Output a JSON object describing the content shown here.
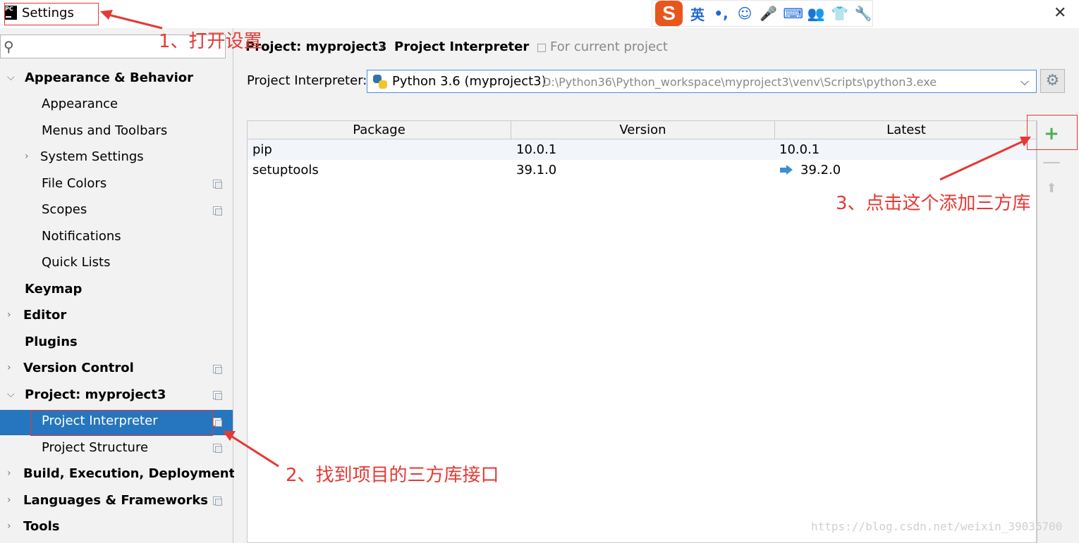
{
  "window": {
    "title": "Settings",
    "app_icon_text": "PC",
    "close_icon": "close-icon"
  },
  "ime_bar": {
    "logo": "S",
    "items": [
      "英",
      "•,",
      "☺",
      "🎤",
      "⌨",
      "👥",
      "👕",
      "🔧"
    ]
  },
  "sidebar": {
    "search_placeholder": "",
    "items": [
      {
        "label": "Appearance & Behavior",
        "bold": true,
        "expanded": true,
        "indent": 0
      },
      {
        "label": "Appearance",
        "indent": 1
      },
      {
        "label": "Menus and Toolbars",
        "indent": 1
      },
      {
        "label": "System Settings",
        "indent": 1,
        "collapsed": true
      },
      {
        "label": "File Colors",
        "indent": 1,
        "project_icon": true
      },
      {
        "label": "Scopes",
        "indent": 1,
        "project_icon": true
      },
      {
        "label": "Notifications",
        "indent": 1
      },
      {
        "label": "Quick Lists",
        "indent": 1
      },
      {
        "label": "Keymap",
        "bold": true,
        "indent": 0
      },
      {
        "label": "Editor",
        "bold": true,
        "collapsed": true,
        "indent": 0
      },
      {
        "label": "Plugins",
        "bold": true,
        "indent": 0
      },
      {
        "label": "Version Control",
        "bold": true,
        "collapsed": true,
        "indent": 0,
        "project_icon": true
      },
      {
        "label": "Project: myproject3",
        "bold": true,
        "expanded": true,
        "indent": 0,
        "project_icon": true
      },
      {
        "label": "Project Interpreter",
        "indent": 1,
        "project_icon": true,
        "selected": true
      },
      {
        "label": "Project Structure",
        "indent": 1,
        "project_icon": true
      },
      {
        "label": "Build, Execution, Deployment",
        "bold": true,
        "collapsed": true,
        "indent": 0
      },
      {
        "label": "Languages & Frameworks",
        "bold": true,
        "collapsed": true,
        "indent": 0,
        "project_icon": true
      },
      {
        "label": "Tools",
        "bold": true,
        "collapsed": true,
        "indent": 0
      }
    ]
  },
  "main": {
    "breadcrumb_parent": "Project: myproject3",
    "breadcrumb_separator": "›",
    "breadcrumb_current": "Project Interpreter",
    "scope_note": "For current project",
    "interpreter_label": "Project Interpreter:",
    "interpreter_name": "Python 3.6 (myproject3)",
    "interpreter_path": "D:\\Python36\\Python_workspace\\myproject3\\venv\\Scripts\\python3.exe",
    "table": {
      "columns": [
        "Package",
        "Version",
        "Latest"
      ],
      "rows": [
        {
          "package": "pip",
          "version": "10.0.1",
          "latest": "10.0.1",
          "upgrade": false
        },
        {
          "package": "setuptools",
          "version": "39.1.0",
          "latest": "39.2.0",
          "upgrade": true
        }
      ]
    },
    "toolbar": {
      "add": "+",
      "remove": "—",
      "upgrade": "⬆"
    }
  },
  "annotations": {
    "step1": "1、打开设置",
    "step2": "2、找到项目的三方库接口",
    "step3": "3、点击这个添加三方库",
    "color": "#e53935"
  },
  "watermark": "https://blog.csdn.net/weixin_39036700"
}
